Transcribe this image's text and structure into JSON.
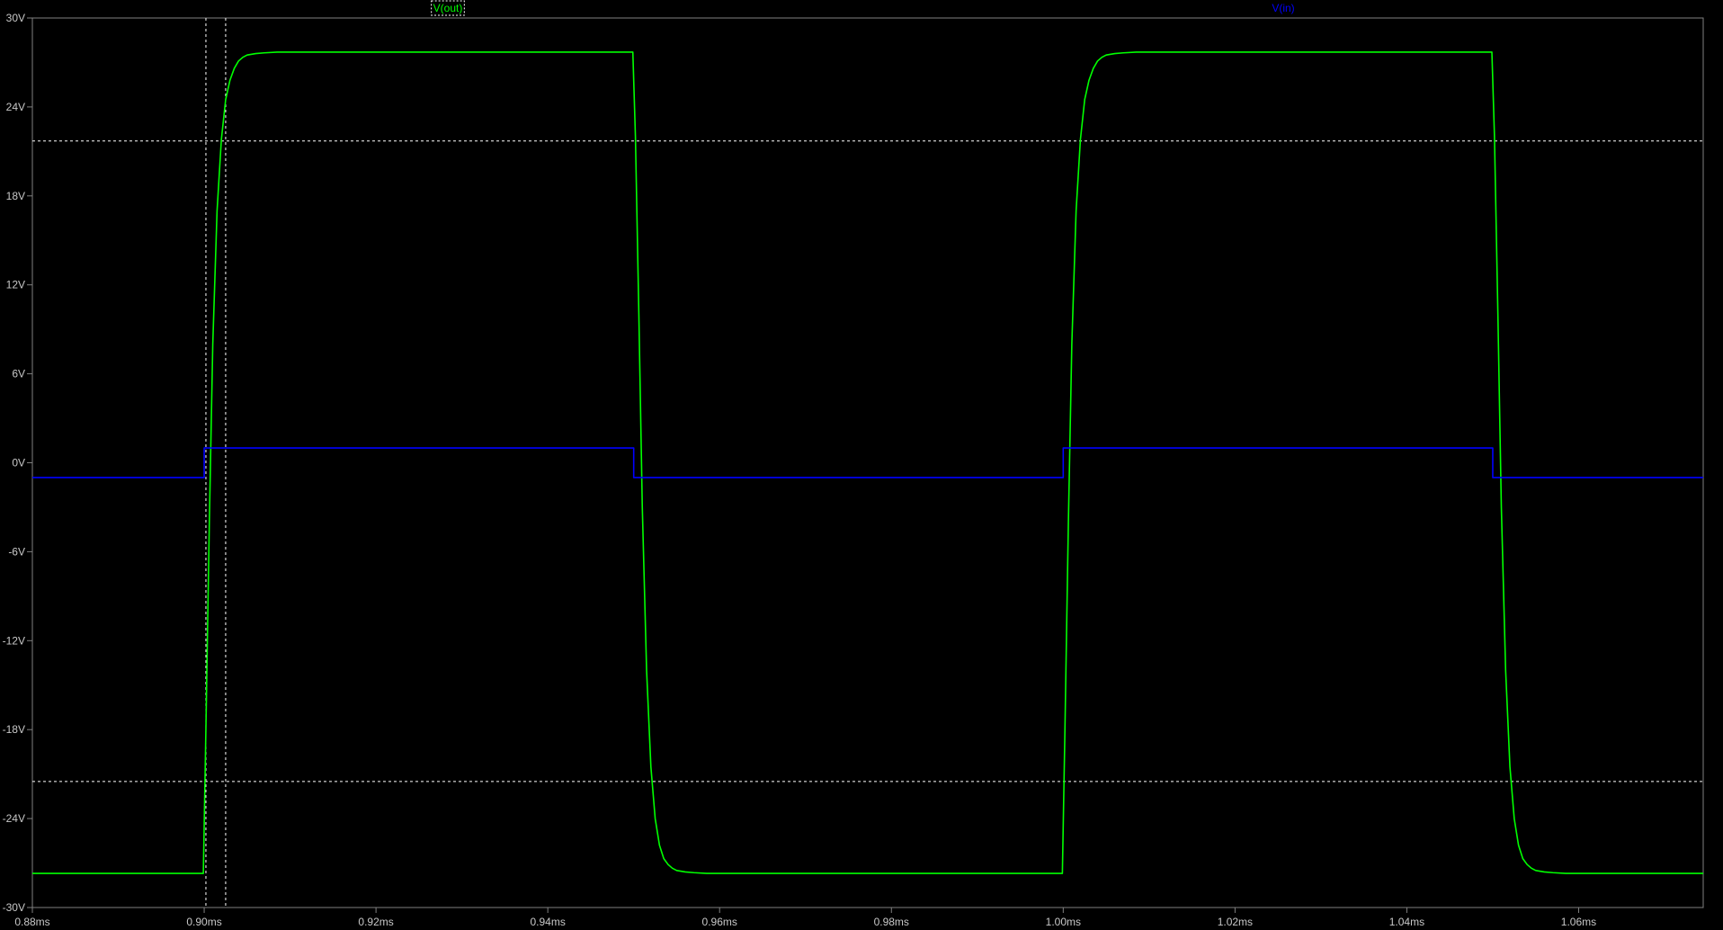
{
  "chart_data": {
    "type": "line",
    "xlim": [
      0.88,
      1.0745
    ],
    "ylim": [
      -30,
      30
    ],
    "x_ticks": [
      "0.88ms",
      "0.90ms",
      "0.92ms",
      "0.94ms",
      "0.96ms",
      "0.98ms",
      "1.00ms",
      "1.02ms",
      "1.04ms",
      "1.06ms"
    ],
    "x_tick_values": [
      0.88,
      0.9,
      0.92,
      0.94,
      0.96,
      0.98,
      1.0,
      1.02,
      1.04,
      1.06
    ],
    "y_ticks": [
      "30V",
      "24V",
      "18V",
      "12V",
      "6V",
      "0V",
      "-6V",
      "-12V",
      "-18V",
      "-24V",
      "-30V"
    ],
    "y_tick_values": [
      30,
      24,
      18,
      12,
      6,
      0,
      -6,
      -12,
      -18,
      -24,
      -30
    ],
    "grid": false,
    "background": "#000000",
    "axis_color": "#808080",
    "series": [
      {
        "name": "V(out)",
        "color": "#00ff00",
        "x": [
          0.88,
          0.8999,
          0.9002,
          0.9006,
          0.901,
          0.9015,
          0.902,
          0.9025,
          0.903,
          0.9035,
          0.904,
          0.9045,
          0.905,
          0.906,
          0.907,
          0.9085,
          0.9499,
          0.9502,
          0.9506,
          0.951,
          0.9515,
          0.952,
          0.9525,
          0.953,
          0.9535,
          0.954,
          0.9545,
          0.955,
          0.956,
          0.957,
          0.9585,
          0.9999,
          1.0002,
          1.0006,
          1.001,
          1.0015,
          1.002,
          1.0025,
          1.003,
          1.0035,
          1.004,
          1.0045,
          1.005,
          1.006,
          1.007,
          1.0085,
          1.0499,
          1.0502,
          1.0506,
          1.051,
          1.0515,
          1.052,
          1.0525,
          1.053,
          1.0535,
          1.054,
          1.0545,
          1.055,
          1.056,
          1.057,
          1.0585,
          1.0745
        ],
        "y": [
          -27.7,
          -27.7,
          -18.0,
          -4.0,
          8.0,
          17.0,
          21.8,
          24.5,
          25.8,
          26.6,
          27.1,
          27.35,
          27.5,
          27.6,
          27.65,
          27.7,
          27.7,
          22.0,
          10.0,
          -3.0,
          -14.0,
          -20.5,
          -24.0,
          -25.8,
          -26.7,
          -27.1,
          -27.35,
          -27.5,
          -27.6,
          -27.65,
          -27.7,
          -27.7,
          -18.0,
          -4.0,
          8.0,
          17.0,
          21.8,
          24.5,
          25.8,
          26.6,
          27.1,
          27.35,
          27.5,
          27.6,
          27.65,
          27.7,
          27.7,
          22.0,
          10.0,
          -3.0,
          -14.0,
          -20.5,
          -24.0,
          -25.8,
          -26.7,
          -27.1,
          -27.35,
          -27.5,
          -27.6,
          -27.65,
          -27.7,
          -27.7
        ]
      },
      {
        "name": "V(in)",
        "color": "#0000ff",
        "x": [
          0.88,
          0.9,
          0.9,
          0.95,
          0.95,
          1.0,
          1.0,
          1.05,
          1.05,
          1.0745
        ],
        "y": [
          -1,
          -1,
          1,
          1,
          -1,
          -1,
          1,
          1,
          -1,
          -1
        ]
      }
    ],
    "cursors": {
      "color": "#ffffff",
      "x": [
        0.9002,
        0.9025
      ],
      "y": [
        21.7,
        -21.5
      ]
    }
  }
}
